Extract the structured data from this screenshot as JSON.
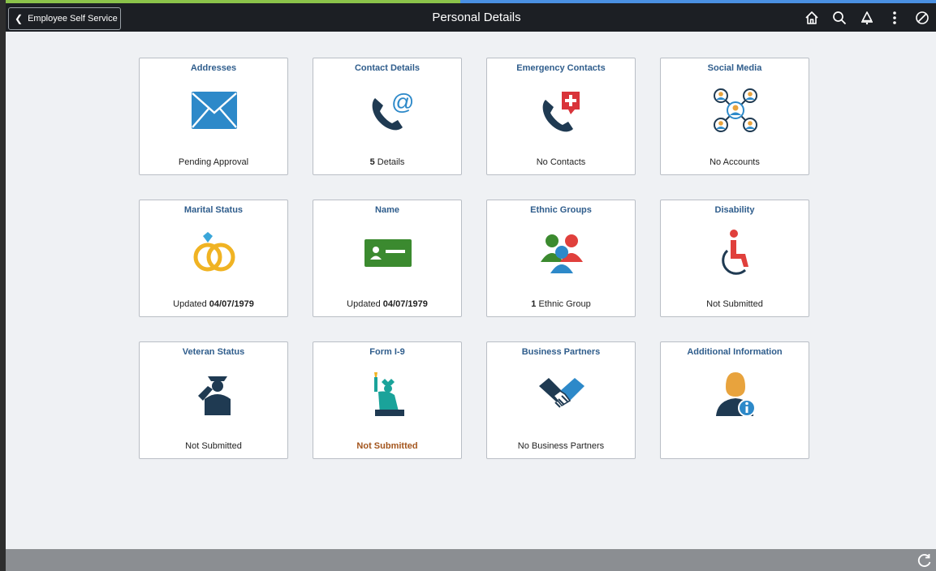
{
  "header": {
    "back_label": "Employee Self Service",
    "title": "Personal Details",
    "icons": [
      "home-icon",
      "search-icon",
      "bell-icon",
      "more-vertical-icon",
      "nav-compass-icon"
    ]
  },
  "colors": {
    "header_bg": "#1c1f24",
    "content_bg": "#eff1f4",
    "tile_title": "#2f5d8c",
    "warning_text": "#a3551d",
    "footer_bg": "#8b8e92"
  },
  "tiles": [
    {
      "title": "Addresses",
      "icon": "envelope-icon",
      "footer": "Pending Approval"
    },
    {
      "title": "Contact Details",
      "icon": "phone-at-icon",
      "footer_bold": "5",
      "footer": "Details"
    },
    {
      "title": "Emergency Contacts",
      "icon": "phone-medical-icon",
      "footer": "No Contacts"
    },
    {
      "title": "Social Media",
      "icon": "social-network-icon",
      "footer": "No Accounts"
    },
    {
      "title": "Marital Status",
      "icon": "rings-icon",
      "footer": "Updated",
      "footer_bold": "04/07/1979"
    },
    {
      "title": "Name",
      "icon": "id-card-icon",
      "footer": "Updated",
      "footer_bold": "04/07/1979"
    },
    {
      "title": "Ethnic Groups",
      "icon": "people-group-icon",
      "footer_bold": "1",
      "footer": "Ethnic Group"
    },
    {
      "title": "Disability",
      "icon": "wheelchair-icon",
      "footer": "Not Submitted"
    },
    {
      "title": "Veteran Status",
      "icon": "saluting-soldier-icon",
      "footer": "Not Submitted"
    },
    {
      "title": "Form I-9",
      "icon": "statue-of-liberty-icon",
      "footer": "Not Submitted"
    },
    {
      "title": "Business Partners",
      "icon": "handshake-icon",
      "footer": "No Business Partners"
    },
    {
      "title": "Additional Information",
      "icon": "person-info-icon",
      "footer": ""
    }
  ],
  "footer": {
    "icon": "refresh-icon"
  }
}
